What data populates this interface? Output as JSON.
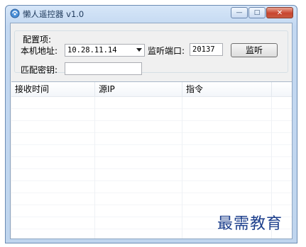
{
  "window": {
    "title": "懒人遥控器 v1.0",
    "controls": {
      "minimize": "—",
      "maximize": "□",
      "close": "✕"
    }
  },
  "config": {
    "group_label": "配置项:",
    "local_address_label": "本机地址:",
    "local_address_value": "10.28.11.14",
    "port_label": "监听端口:",
    "port_value": "20137",
    "listen_button": "监听",
    "key_label": "匹配密钥:",
    "key_value": ""
  },
  "table": {
    "columns": [
      "接收时间",
      "源IP",
      "指令",
      ""
    ],
    "rows": []
  },
  "watermark": "最需教育",
  "colors": {
    "title_text": "#1e395b",
    "close_button": "#c9452f",
    "watermark": "#1d3f8c"
  }
}
